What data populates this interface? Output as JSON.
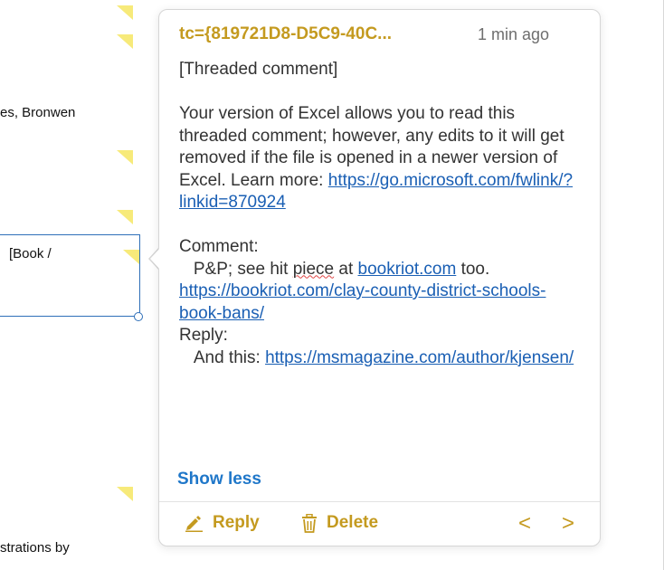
{
  "sheet": {
    "cell_texts": [
      "es, Bronwen",
      "[Book /",
      "strations by"
    ]
  },
  "comment": {
    "author": "tc={819721D8-D5C9-40C...",
    "time": "1 min ago",
    "tag": "[Threaded comment]",
    "notice_text": "Your version of Excel allows you to read this threaded comment; however, any edits to it will get removed if the file is opened in a newer version of Excel. Learn more: ",
    "notice_link": "https://go.microsoft.com/fwlink/?linkid=870924",
    "comment_label": "Comment:",
    "comment_text_before": "P&P; see hit ",
    "comment_misspelled": "piece",
    "comment_text_after": " at ",
    "comment_link1": "bookriot.com",
    "comment_text_end": " too.",
    "comment_link2": "https://bookriot.com/clay-county-district-schools-book-bans/",
    "reply_label": "Reply:",
    "reply_text": "And this: ",
    "reply_link": "https://msmagazine.com/author/kjensen/",
    "show_less": "Show less"
  },
  "footer": {
    "reply_label": "Reply",
    "delete_label": "Delete",
    "prev_arrow": "<",
    "next_arrow": ">"
  },
  "colors": {
    "accent": "#c49a1f",
    "link": "#1a5fb4",
    "show_less": "#1f77c9",
    "comment_marker": "#f7ea7a",
    "selection": "#2e6fb8"
  }
}
